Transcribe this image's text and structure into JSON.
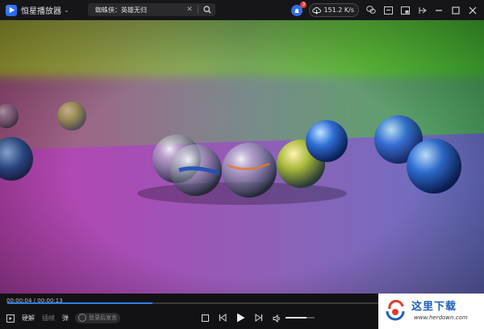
{
  "app": {
    "name": "恒星播放器"
  },
  "search": {
    "query": "蜘蛛侠：英雄无归"
  },
  "status": {
    "notifications": "3",
    "download_speed": "151.2 K/s"
  },
  "player": {
    "time_current": "00:00:04",
    "time_separator": " / ",
    "time_total": "00:00:13",
    "progress_fraction": 0.31,
    "volume_fraction": 0.72
  },
  "controls": {
    "hw_decode_label": "硬解",
    "screenshot_label": "插帧",
    "danmaku_label": "弹",
    "danmaku_placeholder": "登录后发言"
  },
  "watermark": {
    "name": "这里下载",
    "url": "www.herdown.com"
  },
  "colors": {
    "accent": "#2f7cf6",
    "brand": "#2563eb",
    "badge": "#e53935"
  }
}
